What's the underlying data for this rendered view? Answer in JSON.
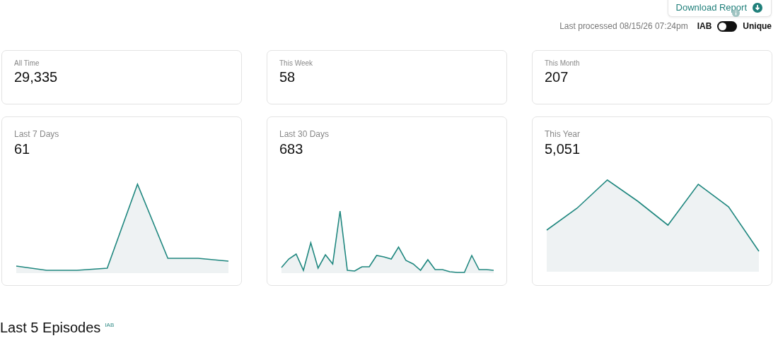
{
  "download_button": {
    "label": "Download Report"
  },
  "status": {
    "last_processed": "Last processed 08/15/26 07:24pm",
    "toggle_left": "IAB",
    "toggle_right": "Unique",
    "toggle_on": false
  },
  "summary_cards": [
    {
      "label": "All Time",
      "value": "29,335"
    },
    {
      "label": "This Week",
      "value": "58"
    },
    {
      "label": "This Month",
      "value": "207"
    }
  ],
  "trend_cards": [
    {
      "label": "Last 7 Days",
      "value": "61"
    },
    {
      "label": "Last 30 Days",
      "value": "683"
    },
    {
      "label": "This Year",
      "value": "5,051"
    }
  ],
  "section": {
    "title": "Last 5 Episodes",
    "badge": "IAB"
  }
}
